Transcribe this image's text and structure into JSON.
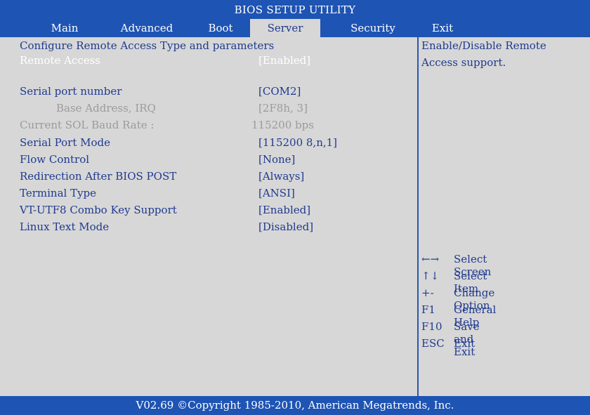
{
  "title": "BIOS SETUP UTILITY",
  "tabs": [
    "Main",
    "Advanced",
    "Boot",
    "Server",
    "Security",
    "Exit"
  ],
  "active_tab": "Server",
  "section_header": "Configure Remote Access Type and parameters",
  "settings": [
    {
      "label": "Remote Access",
      "value": "[Enabled]"
    },
    {
      "label": "Serial port number",
      "value": "[COM2]"
    },
    {
      "label": "Base Address, IRQ",
      "value": "[2F8h, 3]"
    },
    {
      "label": "Current SOL Baud Rate :",
      "value": "115200 bps"
    },
    {
      "label": "Serial Port Mode",
      "value": "[115200 8,n,1]"
    },
    {
      "label": "Flow Control",
      "value": "[None]"
    },
    {
      "label": "Redirection After BIOS POST",
      "value": "[Always]"
    },
    {
      "label": "Terminal Type",
      "value": "[ANSI]"
    },
    {
      "label": "VT-UTF8 Combo Key Support",
      "value": "[Enabled]"
    },
    {
      "label": "Linux Text Mode",
      "value": "[Disabled]"
    }
  ],
  "help": {
    "line1": "Enable/Disable Remote",
    "line2": "Access support."
  },
  "keys": [
    {
      "key": "←→",
      "desc": "Select Screen"
    },
    {
      "key": "↑↓",
      "desc": "Select Item"
    },
    {
      "key": "+-",
      "desc": "Change Option"
    },
    {
      "key": "F1",
      "desc": "General Help"
    },
    {
      "key": "F10",
      "desc": "Save and Exit"
    },
    {
      "key": "ESC",
      "desc": "Exit"
    }
  ],
  "footer": "V02.69 ©Copyright 1985-2010, American Megatrends, Inc.",
  "colors": {
    "bar_blue": "#1e54b3",
    "panel_gray": "#d7d7d7",
    "text_blue": "#1f3a8f",
    "disabled_gray": "#9b9b9b",
    "highlight_white": "#ffffff"
  }
}
